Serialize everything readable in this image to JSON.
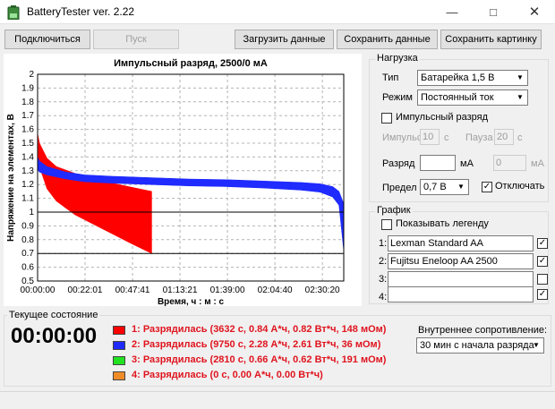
{
  "window": {
    "title": "BatteryTester ver. 2.22"
  },
  "toolbar": {
    "connect": "Подключиться",
    "start": "Пуск",
    "load": "Загрузить данные",
    "save_data": "Сохранить данные",
    "save_image": "Сохранить картинку"
  },
  "chart_data": {
    "type": "area",
    "title": "Импульсный разряд, 2500/0 мА",
    "xlabel": "Время, ч : м : с",
    "ylabel": "Напряжение на элементах, В",
    "ylim": [
      0.5,
      2.0
    ],
    "y_ticks": [
      "0.5",
      "0.6",
      "0.7",
      "0.8",
      "0.9",
      "1",
      "1.1",
      "1.2",
      "1.3",
      "1.4",
      "1.5",
      "1.6",
      "1.7",
      "1.8",
      "1.9",
      "2"
    ],
    "x_ticks": [
      "00:00:00",
      "00:22:01",
      "00:47:41",
      "01:13:21",
      "01:39:00",
      "02:04:40",
      "02:30:20"
    ],
    "x_range_seconds": [
      0,
      9750
    ],
    "reference_lines": [
      1.0,
      0.7
    ],
    "grid": true,
    "series": [
      {
        "name": "Lexman Standard AA",
        "color": "#ff0000",
        "x_seconds": [
          0,
          60,
          300,
          600,
          1200,
          1800,
          2400,
          3000,
          3632
        ],
        "upper": [
          1.57,
          1.5,
          1.39,
          1.33,
          1.28,
          1.24,
          1.21,
          1.18,
          1.15
        ],
        "lower": [
          1.4,
          1.33,
          1.17,
          1.08,
          0.98,
          0.91,
          0.84,
          0.77,
          0.7
        ]
      },
      {
        "name": "Fujitsu Eneloop AA 2500",
        "color": "#1f2bff",
        "x_seconds": [
          0,
          60,
          300,
          900,
          1500,
          2400,
          3600,
          4800,
          6000,
          7200,
          8400,
          9000,
          9400,
          9600,
          9750
        ],
        "upper": [
          1.4,
          1.37,
          1.33,
          1.29,
          1.27,
          1.26,
          1.25,
          1.24,
          1.235,
          1.225,
          1.215,
          1.205,
          1.185,
          1.15,
          1.06
        ],
        "lower": [
          1.31,
          1.29,
          1.27,
          1.24,
          1.22,
          1.21,
          1.2,
          1.19,
          1.185,
          1.175,
          1.16,
          1.145,
          1.11,
          1.05,
          0.72
        ]
      }
    ]
  },
  "load_panel": {
    "title": "Нагрузка",
    "type_label": "Тип",
    "type_value": "Батарейка 1,5 В",
    "mode_label": "Режим",
    "mode_value": "Постоянный ток",
    "pulse_label": "Импульсный разряд",
    "pulse_checked": false,
    "impulse_label": "Импульс",
    "impulse_value": "10",
    "impulse_unit": "с",
    "pause_label": "Пауза",
    "pause_value": "20",
    "pause_unit": "с",
    "discharge_label": "Разряд",
    "discharge_unit": "мА",
    "discharge_value2": "0",
    "discharge_unit2": "мА",
    "limit_label": "Предел",
    "limit_value": "0,7 В",
    "disconnect_label": "Отключать",
    "disconnect_checked": true
  },
  "graph_panel": {
    "title": "График",
    "legend_label": "Показывать легенду",
    "legend_checked": false,
    "rows": [
      {
        "num": "1:",
        "value": "Lexman Standard AA",
        "checked": true
      },
      {
        "num": "2:",
        "value": "Fujitsu Eneloop AA 2500",
        "checked": true
      },
      {
        "num": "3:",
        "value": "",
        "checked": false
      },
      {
        "num": "4:",
        "value": "",
        "checked": true
      }
    ]
  },
  "status": {
    "title": "Текущее состояние",
    "timer": "00:00:00",
    "lines": [
      {
        "color": "#ff0000",
        "text": "1: Разрядилась (3632 с, 0.84 А*ч, 0.82 Вт*ч, 148 мОм)"
      },
      {
        "color": "#1f2bff",
        "text": "2: Разрядилась (9750 с, 2.28 А*ч, 2.61 Вт*ч, 36 мОм)"
      },
      {
        "color": "#22e222",
        "text": "3: Разрядилась (2810 с, 0.66 А*ч, 0.62 Вт*ч, 191 мОм)"
      },
      {
        "color": "#f08c28",
        "text": "4: Разрядилась (0 с, 0.00 А*ч, 0.00 Вт*ч)"
      }
    ],
    "resistance_label": "Внутреннее сопротивление:",
    "resistance_value": "30 мин с начала разряда"
  }
}
